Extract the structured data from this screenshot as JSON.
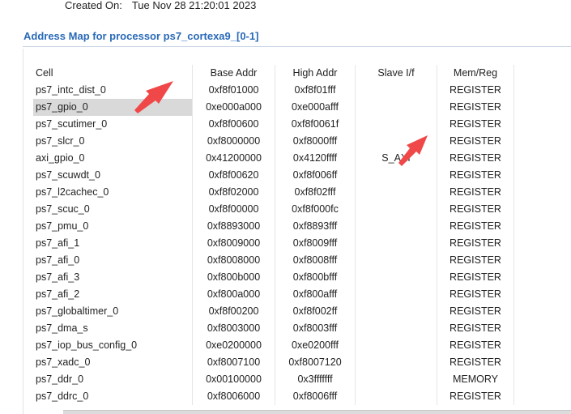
{
  "header": {
    "created_label": "Created On:",
    "created_value": "Tue Nov 28 21:20:01 2023"
  },
  "section": {
    "title": "Address Map for processor ps7_cortexa9_[0-1]"
  },
  "table": {
    "columns": [
      "Cell",
      "Base Addr",
      "High Addr",
      "Slave I/f",
      "Mem/Reg"
    ],
    "rows": [
      {
        "cell": "ps7_intc_dist_0",
        "base": "0xf8f01000",
        "high": "0xf8f01fff",
        "slave": "",
        "mem": "REGISTER"
      },
      {
        "cell": "ps7_gpio_0",
        "base": "0xe000a000",
        "high": "0xe000afff",
        "slave": "",
        "mem": "REGISTER"
      },
      {
        "cell": "ps7_scutimer_0",
        "base": "0xf8f00600",
        "high": "0xf8f0061f",
        "slave": "",
        "mem": "REGISTER"
      },
      {
        "cell": "ps7_slcr_0",
        "base": "0xf8000000",
        "high": "0xf8000fff",
        "slave": "",
        "mem": "REGISTER"
      },
      {
        "cell": "axi_gpio_0",
        "base": "0x41200000",
        "high": "0x4120ffff",
        "slave": "S_AXI",
        "mem": "REGISTER"
      },
      {
        "cell": "ps7_scuwdt_0",
        "base": "0xf8f00620",
        "high": "0xf8f006ff",
        "slave": "",
        "mem": "REGISTER"
      },
      {
        "cell": "ps7_l2cachec_0",
        "base": "0xf8f02000",
        "high": "0xf8f02fff",
        "slave": "",
        "mem": "REGISTER"
      },
      {
        "cell": "ps7_scuc_0",
        "base": "0xf8f00000",
        "high": "0xf8f000fc",
        "slave": "",
        "mem": "REGISTER"
      },
      {
        "cell": "ps7_pmu_0",
        "base": "0xf8893000",
        "high": "0xf8893fff",
        "slave": "",
        "mem": "REGISTER"
      },
      {
        "cell": "ps7_afi_1",
        "base": "0xf8009000",
        "high": "0xf8009fff",
        "slave": "",
        "mem": "REGISTER"
      },
      {
        "cell": "ps7_afi_0",
        "base": "0xf8008000",
        "high": "0xf8008fff",
        "slave": "",
        "mem": "REGISTER"
      },
      {
        "cell": "ps7_afi_3",
        "base": "0xf800b000",
        "high": "0xf800bfff",
        "slave": "",
        "mem": "REGISTER"
      },
      {
        "cell": "ps7_afi_2",
        "base": "0xf800a000",
        "high": "0xf800afff",
        "slave": "",
        "mem": "REGISTER"
      },
      {
        "cell": "ps7_globaltimer_0",
        "base": "0xf8f00200",
        "high": "0xf8f002ff",
        "slave": "",
        "mem": "REGISTER"
      },
      {
        "cell": "ps7_dma_s",
        "base": "0xf8003000",
        "high": "0xf8003fff",
        "slave": "",
        "mem": "REGISTER"
      },
      {
        "cell": "ps7_iop_bus_config_0",
        "base": "0xe0200000",
        "high": "0xe0200fff",
        "slave": "",
        "mem": "REGISTER"
      },
      {
        "cell": "ps7_xadc_0",
        "base": "0xf8007100",
        "high": "0xf8007120",
        "slave": "",
        "mem": "REGISTER"
      },
      {
        "cell": "ps7_ddr_0",
        "base": "0x00100000",
        "high": "0x3fffffff",
        "slave": "",
        "mem": "MEMORY"
      },
      {
        "cell": "ps7_ddrc_0",
        "base": "0xf8006000",
        "high": "0xf8006fff",
        "slave": "",
        "mem": "REGISTER"
      }
    ],
    "selected_row": "ps7_gpio_0"
  },
  "colors": {
    "title": "#2a6ab8",
    "selection": "#d9d9d9",
    "annotation_arrow": "#f04848"
  },
  "annotations": {
    "arrow_icon": "arrow-icon"
  }
}
